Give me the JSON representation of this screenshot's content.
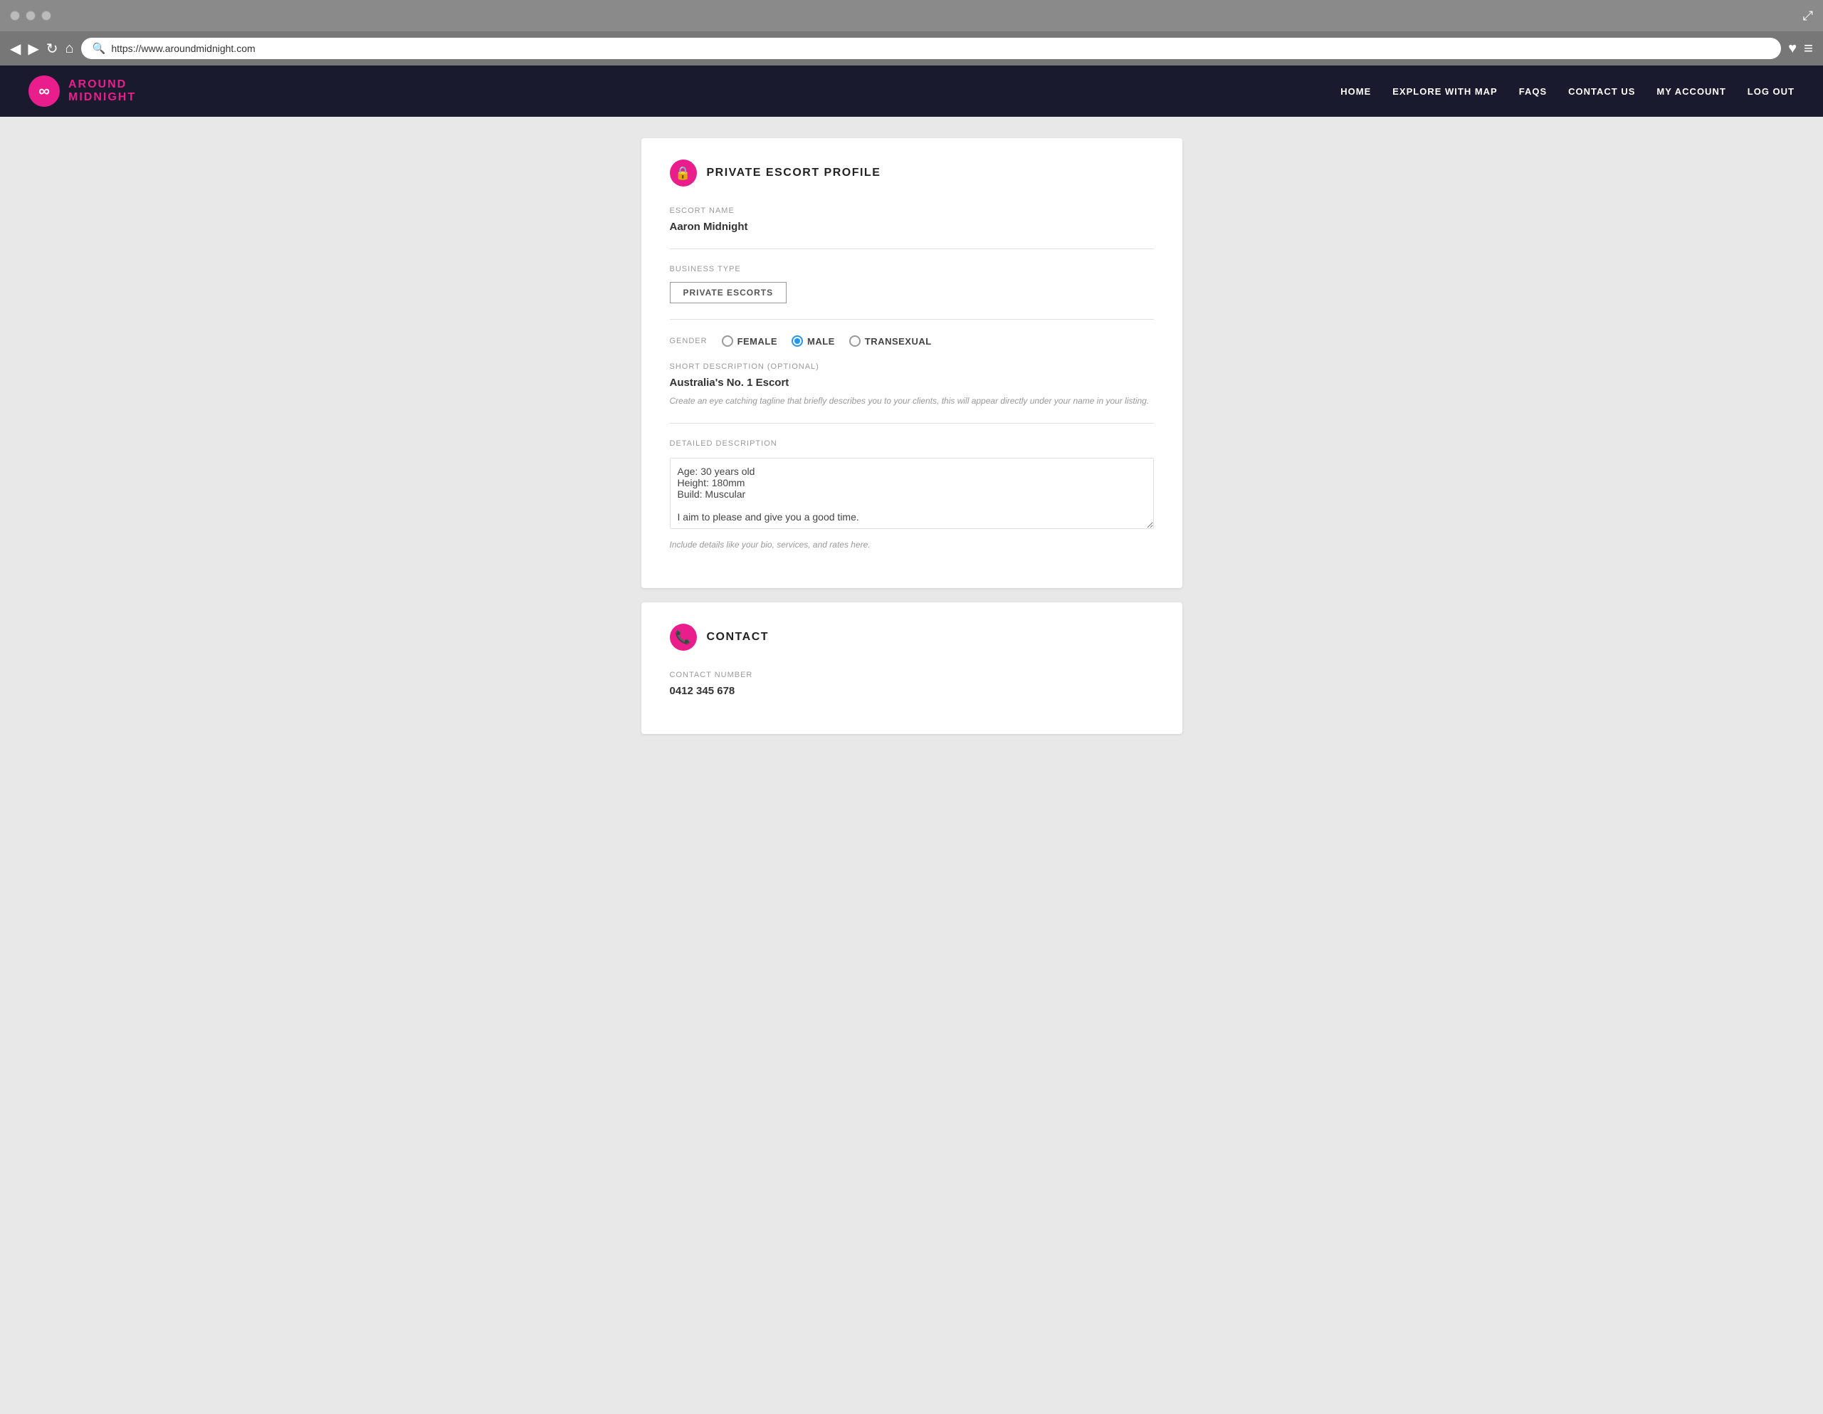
{
  "browser": {
    "url": "https://www.aroundmidnight.com",
    "back_icon": "◀",
    "forward_icon": "▶",
    "refresh_icon": "↻",
    "home_icon": "⌂",
    "search_icon": "🔍",
    "heart_icon": "♥",
    "menu_icon": "≡",
    "expand_icon": "⤢"
  },
  "site": {
    "name_line1": "AROUND",
    "name_line2": "MIDNIGHT",
    "nav": [
      {
        "label": "HOME",
        "href": "#"
      },
      {
        "label": "EXPLORE WITH MAP",
        "href": "#"
      },
      {
        "label": "FAQS",
        "href": "#"
      },
      {
        "label": "CONTACT US",
        "href": "#"
      },
      {
        "label": "MY ACCOUNT",
        "href": "#"
      },
      {
        "label": "LOG OUT",
        "href": "#"
      }
    ]
  },
  "profile_card": {
    "icon": "🔒",
    "title": "PRIVATE ESCORT PROFILE",
    "escort_name_label": "ESCORT NAME",
    "escort_name_value": "Aaron Midnight",
    "business_type_label": "BUSINESS TYPE",
    "business_type_value": "PRIVATE ESCORTS",
    "gender_label": "GENDER",
    "gender_options": [
      {
        "label": "FEMALE",
        "selected": false
      },
      {
        "label": "MALE",
        "selected": true
      },
      {
        "label": "TRANSEXUAL",
        "selected": false
      }
    ],
    "short_desc_label": "SHORT DESCRIPTION (OPTIONAL)",
    "short_desc_value": "Australia's No. 1 Escort",
    "short_desc_hint": "Create an eye catching tagline that briefly describes you to your clients, this will appear directly under your name in your listing.",
    "detailed_desc_label": "DETAILED DESCRIPTION",
    "detailed_desc_lines": [
      "Age: 30 years old",
      "Height: 180mm",
      "Build: Muscular",
      "",
      "I aim to please and give you a good time."
    ],
    "detailed_desc_hint": "Include details like your bio, services, and rates here."
  },
  "contact_card": {
    "icon": "📞",
    "title": "CONTACT",
    "contact_number_label": "CONTACT NUMBER",
    "contact_number_value": "0412 345 678"
  }
}
